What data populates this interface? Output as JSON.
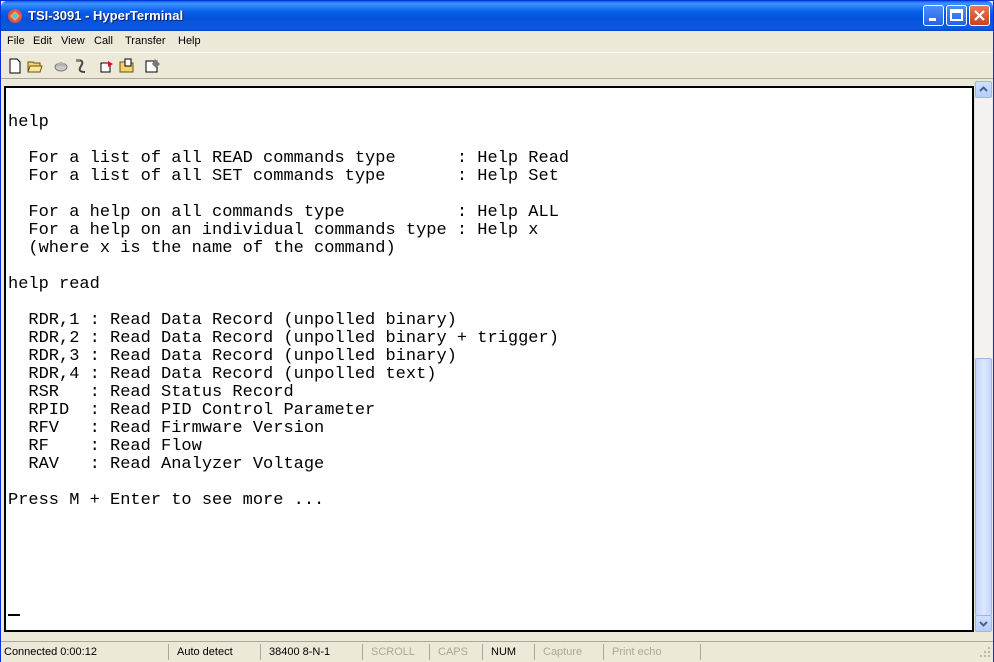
{
  "window": {
    "title": "TSI-3091 - HyperTerminal"
  },
  "menu": [
    "File",
    "Edit",
    "View",
    "Call",
    "Transfer",
    "Help"
  ],
  "toolbar": {
    "icons": [
      "new-connection-icon",
      "open-icon",
      "connect-icon",
      "disconnect-icon",
      "send-icon",
      "receive-icon",
      "properties-icon"
    ]
  },
  "terminal": {
    "lines": [
      "help",
      "",
      "  For a list of all READ commands type      : Help Read",
      "  For a list of all SET commands type       : Help Set",
      "",
      "  For a help on all commands type           : Help ALL",
      "  For a help on an individual commands type : Help x",
      "  (where x is the name of the command)",
      "",
      "help read",
      "",
      "  RDR,1 : Read Data Record (unpolled binary)",
      "  RDR,2 : Read Data Record (unpolled binary + trigger)",
      "  RDR,3 : Read Data Record (unpolled binary)",
      "  RDR,4 : Read Data Record (unpolled text)",
      "  RSR   : Read Status Record",
      "  RPID  : Read PID Control Parameter",
      "  RFV   : Read Firmware Version",
      "  RF    : Read Flow",
      "  RAV   : Read Analyzer Voltage",
      "",
      "Press M + Enter to see more ..."
    ]
  },
  "status": {
    "connected": "Connected 0:00:12",
    "detect": "Auto detect",
    "settings": "38400 8-N-1",
    "scroll": "SCROLL",
    "caps": "CAPS",
    "num": "NUM",
    "capture": "Capture",
    "print_echo": "Print echo"
  }
}
